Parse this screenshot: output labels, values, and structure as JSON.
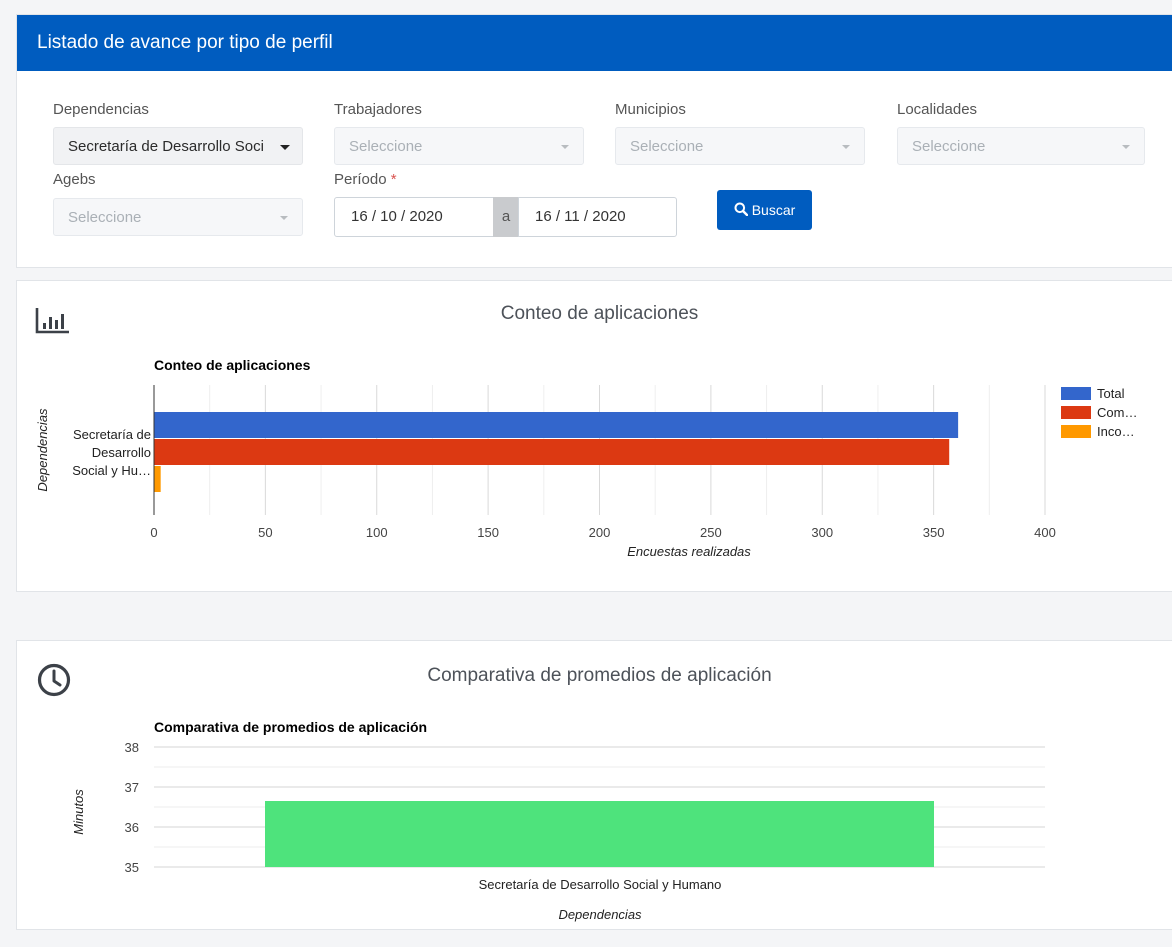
{
  "header": {
    "title": "Listado de avance por tipo de perfil"
  },
  "filters": {
    "dependencias": {
      "label": "Dependencias",
      "value": "Secretaría de Desarrollo Soci"
    },
    "trabajadores": {
      "label": "Trabajadores",
      "placeholder": "Seleccione"
    },
    "municipios": {
      "label": "Municipios",
      "placeholder": "Seleccione"
    },
    "localidades": {
      "label": "Localidades",
      "placeholder": "Seleccione"
    },
    "agebs": {
      "label": "Agebs",
      "placeholder": "Seleccione"
    },
    "periodo": {
      "label": "Período",
      "required_mark": "*",
      "start": "16 / 10 / 2020",
      "separator": "a",
      "end": "16 / 11 / 2020"
    },
    "search_button": "Buscar"
  },
  "section1": {
    "title": "Conteo de aplicaciones",
    "icon": "bar-chart-icon",
    "chart_data": {
      "type": "bar",
      "orientation": "horizontal",
      "title": "Conteo de aplicaciones",
      "xlabel": "Encuestas realizadas",
      "ylabel": "Dependencias",
      "xlim": [
        0,
        400
      ],
      "xticks": [
        0,
        50,
        100,
        150,
        200,
        250,
        300,
        350,
        400
      ],
      "categories": [
        "Secretaría de Desarrollo Social y Hu…"
      ],
      "category_label_lines": [
        "Secretaría de",
        "Desarrollo",
        "Social y Hu…"
      ],
      "series": [
        {
          "name": "Total",
          "legend_label": "Total",
          "color": "#3366cc",
          "values": [
            361
          ]
        },
        {
          "name": "Com…",
          "legend_label": "Com…",
          "color": "#dc3912",
          "values": [
            357
          ]
        },
        {
          "name": "Inco…",
          "legend_label": "Inco…",
          "color": "#ff9900",
          "values": [
            3
          ]
        }
      ],
      "grid": true,
      "legend_position": "right"
    }
  },
  "section2": {
    "title": "Comparativa de promedios de aplicación",
    "icon": "clock-icon",
    "chart_data": {
      "type": "bar",
      "orientation": "vertical",
      "title": "Comparativa de promedios de aplicación",
      "xlabel": "Dependencias",
      "ylabel": "Minutos",
      "ylim": [
        35,
        38
      ],
      "yticks": [
        35,
        36,
        37,
        38
      ],
      "categories": [
        "Secretaría de Desarrollo Social y Humano"
      ],
      "values": [
        36.65
      ],
      "color": "#4ee37c",
      "grid": true
    }
  }
}
